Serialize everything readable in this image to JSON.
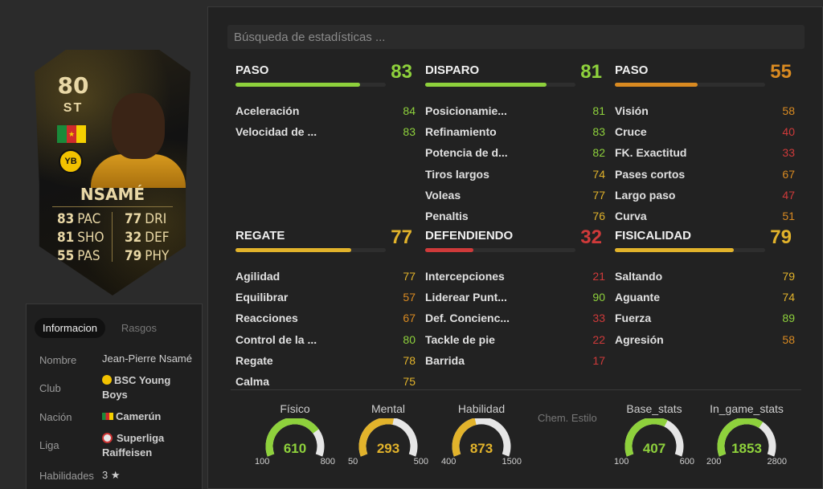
{
  "card": {
    "rating": "80",
    "position": "ST",
    "name": "NSAMÉ",
    "left_stats": [
      {
        "v": "83",
        "k": "PAC"
      },
      {
        "v": "81",
        "k": "SHO"
      },
      {
        "v": "55",
        "k": "PAS"
      }
    ],
    "right_stats": [
      {
        "v": "77",
        "k": "DRI"
      },
      {
        "v": "32",
        "k": "DEF"
      },
      {
        "v": "79",
        "k": "PHY"
      }
    ],
    "club_logo": "YB"
  },
  "info": {
    "tabs": [
      "Informacion",
      "Rasgos"
    ],
    "rows": [
      {
        "label": "Nombre",
        "value": "Jean-Pierre Nsamé"
      },
      {
        "label": "Club",
        "value": "BSC Young Boys"
      },
      {
        "label": "Nación",
        "value": "Camerún"
      },
      {
        "label": "Liga",
        "value": "Superliga Raiffeisen"
      },
      {
        "label": "Habilidades",
        "value": "3 ★"
      }
    ]
  },
  "search": {
    "placeholder": "Búsqueda de estadísticas ..."
  },
  "colors": {
    "green": "#8ed13c",
    "yellow": "#e2b32b",
    "orange": "#d98a21",
    "red": "#cf3a3a"
  },
  "groups": [
    {
      "title": "PASO",
      "value": "83",
      "color": "green",
      "fill": 0.83,
      "items": [
        {
          "label": "Aceleración",
          "value": "84",
          "c": "green"
        },
        {
          "label": "Velocidad de ...",
          "value": "83",
          "c": "green"
        }
      ]
    },
    {
      "title": "DISPARO",
      "value": "81",
      "color": "green",
      "fill": 0.81,
      "items": [
        {
          "label": "Posicionamie...",
          "value": "81",
          "c": "green"
        },
        {
          "label": "Refinamiento",
          "value": "83",
          "c": "green"
        },
        {
          "label": "Potencia de d...",
          "value": "82",
          "c": "green"
        },
        {
          "label": "Tiros largos",
          "value": "74",
          "c": "yellow"
        },
        {
          "label": "Voleas",
          "value": "77",
          "c": "yellow"
        },
        {
          "label": "Penaltis",
          "value": "76",
          "c": "yellow"
        }
      ]
    },
    {
      "title": "PASO",
      "value": "55",
      "color": "orange",
      "fill": 0.55,
      "items": [
        {
          "label": "Visión",
          "value": "58",
          "c": "orange"
        },
        {
          "label": "Cruce",
          "value": "40",
          "c": "red"
        },
        {
          "label": "FK. Exactitud",
          "value": "33",
          "c": "red"
        },
        {
          "label": "Pases cortos",
          "value": "67",
          "c": "orange"
        },
        {
          "label": "Largo paso",
          "value": "47",
          "c": "red"
        },
        {
          "label": "Curva",
          "value": "51",
          "c": "orange"
        }
      ]
    },
    {
      "title": "REGATE",
      "value": "77",
      "color": "yellow",
      "fill": 0.77,
      "items": [
        {
          "label": "Agilidad",
          "value": "77",
          "c": "yellow"
        },
        {
          "label": "Equilibrar",
          "value": "57",
          "c": "orange"
        },
        {
          "label": "Reacciones",
          "value": "67",
          "c": "orange"
        },
        {
          "label": "Control de la ...",
          "value": "80",
          "c": "green"
        },
        {
          "label": "Regate",
          "value": "78",
          "c": "yellow"
        },
        {
          "label": "Calma",
          "value": "75",
          "c": "yellow"
        }
      ]
    },
    {
      "title": "DEFENDIENDO",
      "value": "32",
      "color": "red",
      "fill": 0.32,
      "items": [
        {
          "label": "Intercepciones",
          "value": "21",
          "c": "red"
        },
        {
          "label": "Liderear Punt...",
          "value": "90",
          "c": "green"
        },
        {
          "label": "Def. Concienc...",
          "value": "33",
          "c": "red"
        },
        {
          "label": "Tackle de pie",
          "value": "22",
          "c": "red"
        },
        {
          "label": "Barrida",
          "value": "17",
          "c": "red"
        }
      ]
    },
    {
      "title": "FISICALIDAD",
      "value": "79",
      "color": "yellow",
      "fill": 0.79,
      "items": [
        {
          "label": "Saltando",
          "value": "79",
          "c": "yellow"
        },
        {
          "label": "Aguante",
          "value": "74",
          "c": "yellow"
        },
        {
          "label": "Fuerza",
          "value": "89",
          "c": "green"
        },
        {
          "label": "Agresión",
          "value": "58",
          "c": "orange"
        }
      ]
    }
  ],
  "gauges": [
    {
      "title": "Físico",
      "value": "610",
      "min": "100",
      "max": "800",
      "fill": 0.73,
      "color": "green"
    },
    {
      "title": "Mental",
      "value": "293",
      "min": "50",
      "max": "500",
      "fill": 0.54,
      "color": "yellow"
    },
    {
      "title": "Habilidad",
      "value": "873",
      "min": "400",
      "max": "1500",
      "fill": 0.43,
      "color": "yellow"
    },
    {
      "title": "Base_stats",
      "value": "407",
      "min": "100",
      "max": "600",
      "fill": 0.61,
      "color": "green"
    },
    {
      "title": "In_game_stats",
      "value": "1853",
      "min": "200",
      "max": "2800",
      "fill": 0.64,
      "color": "green"
    }
  ],
  "chem_style": "Chem. Estilo"
}
